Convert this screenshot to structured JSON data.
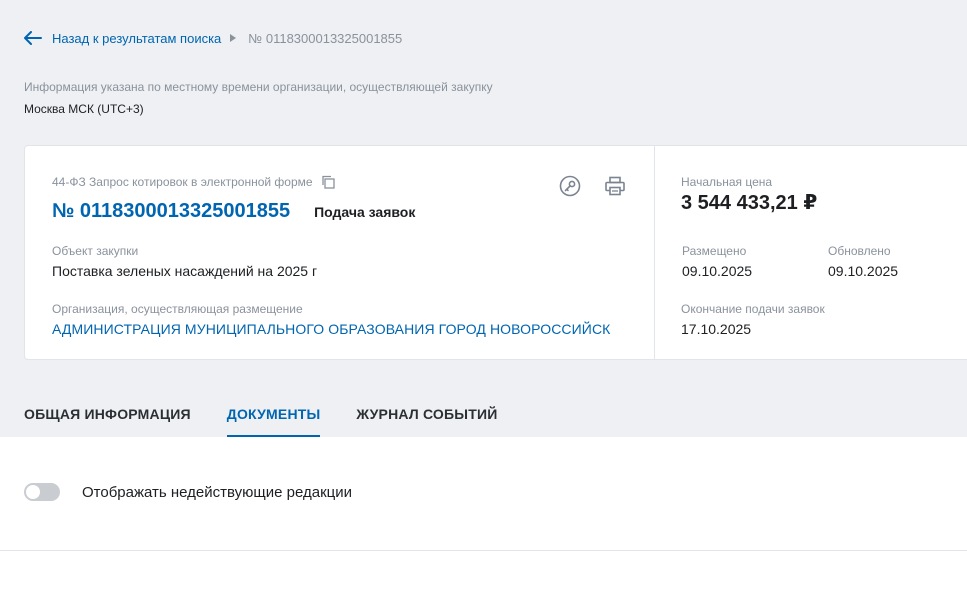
{
  "breadcrumb": {
    "back_label": "Назад к результатам поиска",
    "current": "№ 0118300013325001855"
  },
  "timezone": {
    "note": "Информация указана по местному времени организации, осуществляющей закупку",
    "value": "Москва МСК (UTC+3)"
  },
  "card": {
    "type": "44-ФЗ Запрос котировок в электронной форме",
    "number": "№ 0118300013325001855",
    "status": "Подача заявок",
    "object_label": "Объект закупки",
    "object_value": "Поставка зеленых насаждений на 2025 г",
    "org_label": "Организация, осуществляющая размещение",
    "org_value": "АДМИНИСТРАЦИЯ МУНИЦИПАЛЬНОГО ОБРАЗОВАНИЯ ГОРОД НОВОРОССИЙСК",
    "price_label": "Начальная цена",
    "price_value": "3 544 433,21 ₽",
    "posted_label": "Размещено",
    "posted_value": "09.10.2025",
    "updated_label": "Обновлено",
    "updated_value": "09.10.2025",
    "deadline_label": "Окончание подачи заявок",
    "deadline_value": "17.10.2025",
    "icons": [
      "key-icon",
      "print-icon",
      "copy-icon"
    ]
  },
  "tabs": [
    {
      "label": "ОБЩАЯ ИНФОРМАЦИЯ",
      "active": false
    },
    {
      "label": "ДОКУМЕНТЫ",
      "active": true
    },
    {
      "label": "ЖУРНАЛ СОБЫТИЙ",
      "active": false
    }
  ],
  "toggle": {
    "label": "Отображать недействующие редакции",
    "checked": false
  },
  "colors": {
    "accent": "#0065b1",
    "background": "#eef0f3",
    "muted": "#8a929c"
  }
}
